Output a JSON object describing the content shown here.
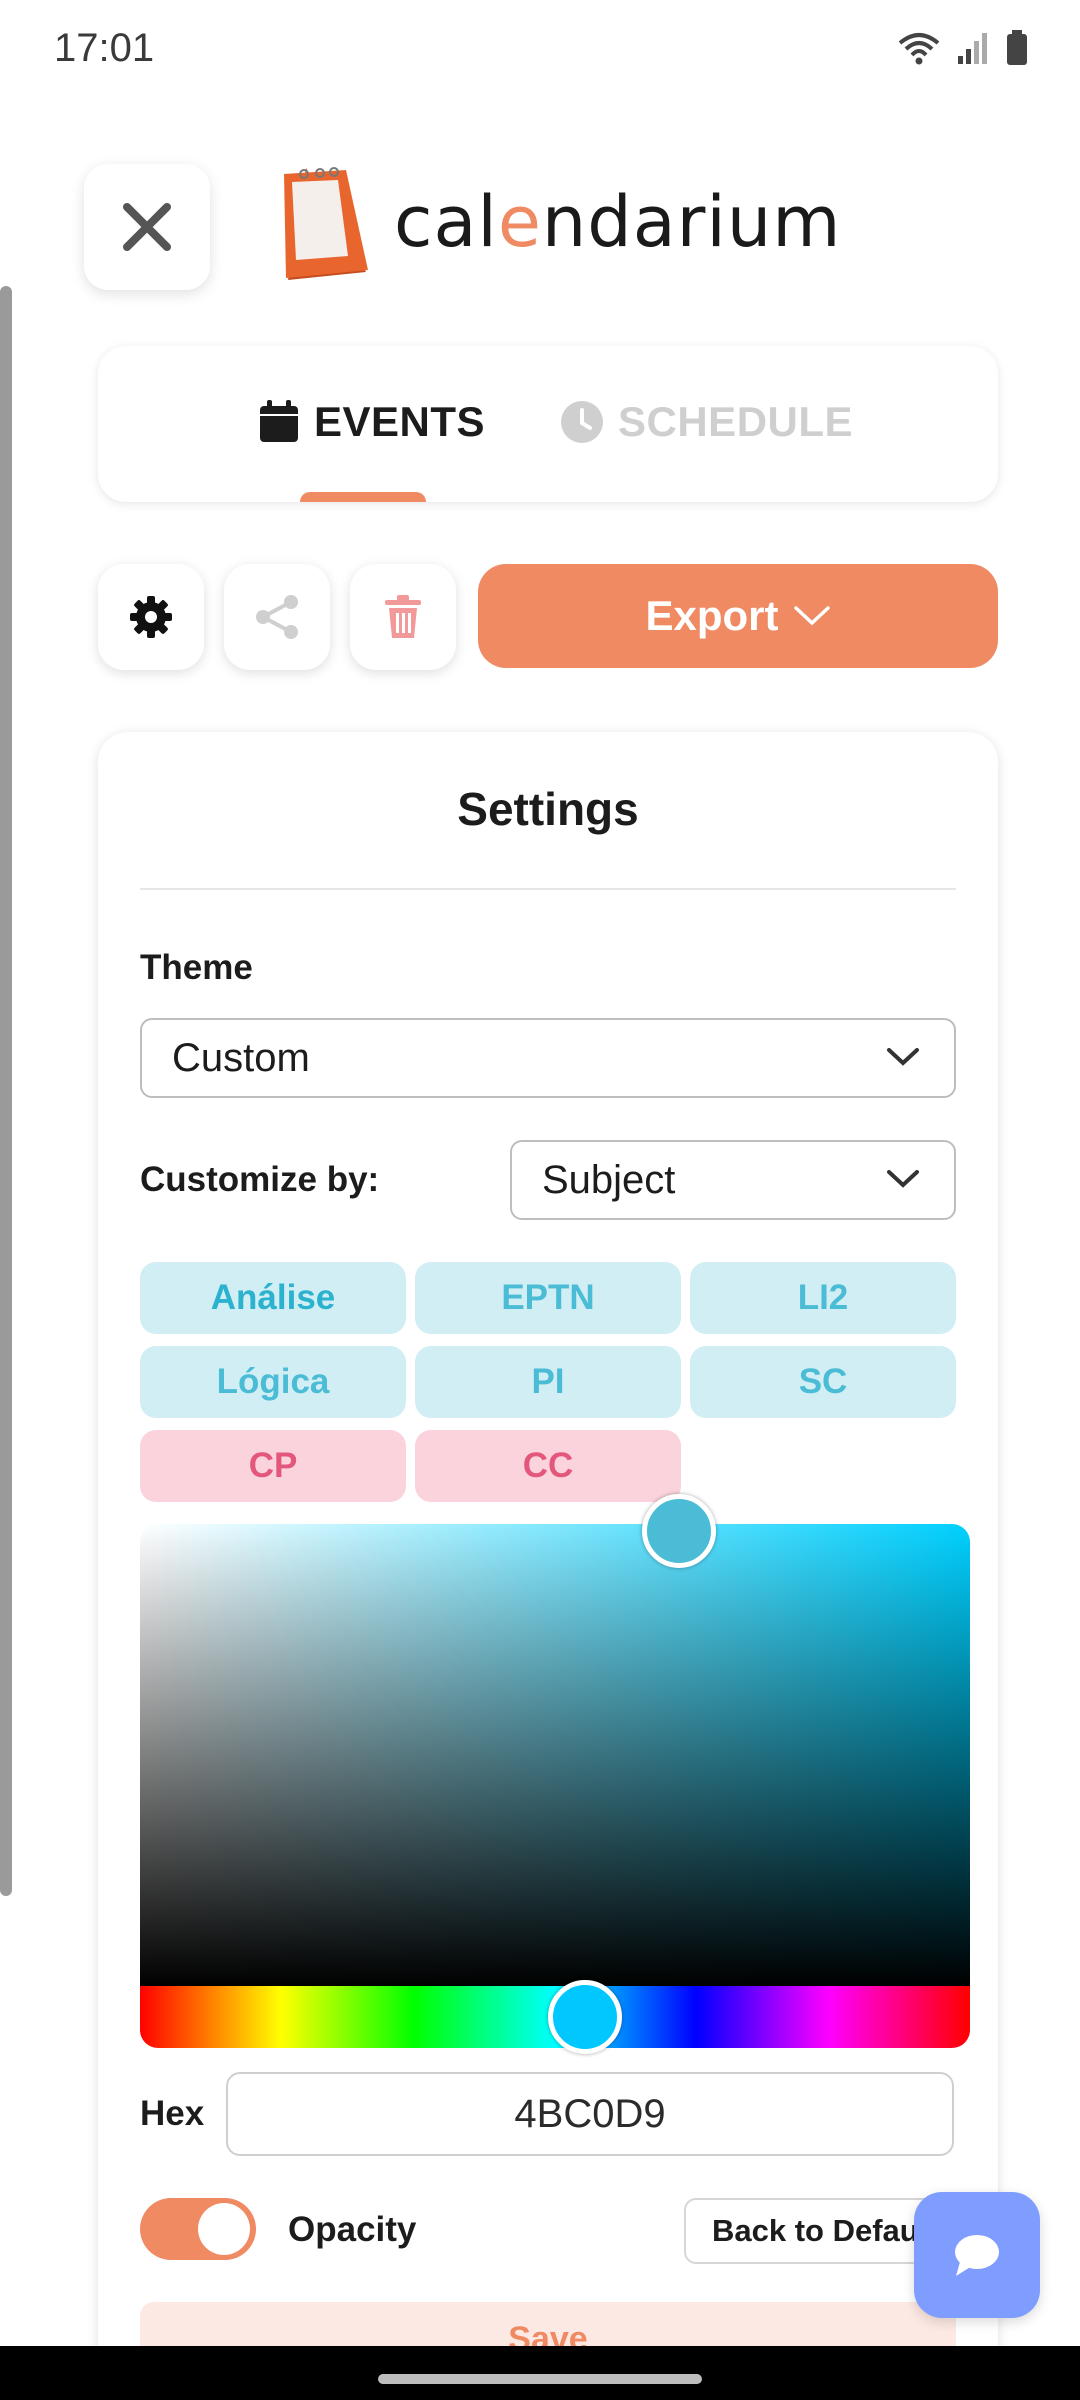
{
  "status_bar": {
    "time": "17:01"
  },
  "header": {
    "logo_text_before": "cal",
    "logo_text_accent": "e",
    "logo_text_after": "ndarium"
  },
  "tabs": [
    {
      "label": "EVENTS",
      "active": true
    },
    {
      "label": "SCHEDULE",
      "active": false
    }
  ],
  "toolbar": {
    "export_label": "Export"
  },
  "settings": {
    "title": "Settings",
    "theme_label": "Theme",
    "theme_value": "Custom",
    "customize_label": "Customize by:",
    "customize_value": "Subject",
    "subjects": [
      {
        "label": "Análise",
        "color": "blue",
        "active": true
      },
      {
        "label": "EPTN",
        "color": "blue"
      },
      {
        "label": "LI2",
        "color": "blue"
      },
      {
        "label": "Lógica",
        "color": "blue"
      },
      {
        "label": "PI",
        "color": "blue"
      },
      {
        "label": "SC",
        "color": "blue"
      },
      {
        "label": "CP",
        "color": "pink"
      },
      {
        "label": "CC",
        "color": "pink"
      }
    ],
    "hex_label": "Hex",
    "hex_value": "4BC0D9",
    "opacity_label": "Opacity",
    "opacity_on": true,
    "back_default_label": "Back to Default",
    "save_label": "Save"
  },
  "colors": {
    "accent": "#ef8a62",
    "chip_blue_bg": "#d1eef4",
    "chip_pink_bg": "#fbd3dc",
    "fab": "#7f9cff"
  }
}
